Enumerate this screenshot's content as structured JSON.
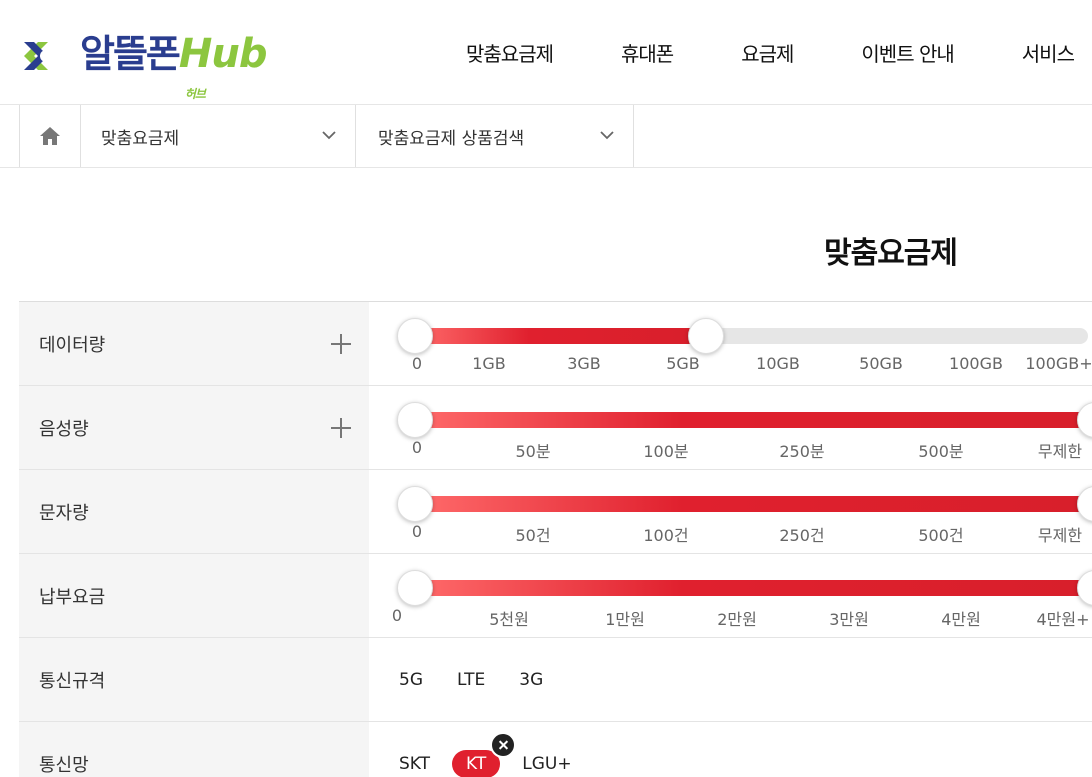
{
  "brand": {
    "name": "알뜰폰",
    "hub": "Hub",
    "sub": "허브",
    "primary_color": "#2a3d8f",
    "accent_color": "#8cc63f"
  },
  "nav": [
    "맞춤요금제",
    "휴대폰",
    "요금제",
    "이벤트 안내",
    "서비스"
  ],
  "breadcrumb": {
    "home_icon": "home-icon",
    "level1": "맞춤요금제",
    "level2": "맞춤요금제 상품검색"
  },
  "page_title": "맞춤요금제",
  "filters": {
    "data": {
      "label": "데이터량",
      "ticks": [
        "0",
        "1GB",
        "3GB",
        "5GB",
        "10GB",
        "50GB",
        "100GB",
        "100GB+"
      ],
      "selected_range": [
        "0",
        "5GB"
      ]
    },
    "voice": {
      "label": "음성량",
      "ticks": [
        "0",
        "50분",
        "100분",
        "250분",
        "500분",
        "무제한"
      ],
      "selected_range": [
        "0",
        "무제한"
      ]
    },
    "sms": {
      "label": "문자량",
      "ticks": [
        "0",
        "50건",
        "100건",
        "250건",
        "500건",
        "무제한"
      ],
      "selected_range": [
        "0",
        "무제한"
      ]
    },
    "fee": {
      "label": "납부요금",
      "ticks": [
        "0",
        "5천원",
        "1만원",
        "2만원",
        "3만원",
        "4만원",
        "4만원+"
      ],
      "selected_range": [
        "0",
        "4만원+"
      ]
    },
    "network_type": {
      "label": "통신규격",
      "options": [
        "5G",
        "LTE",
        "3G"
      ]
    },
    "carrier": {
      "label": "통신망",
      "options": [
        "SKT",
        "KT",
        "LGU+"
      ],
      "selected": "KT"
    }
  },
  "colors": {
    "slider_fill": "#e0202e",
    "selected_chip": "#e0202e"
  }
}
